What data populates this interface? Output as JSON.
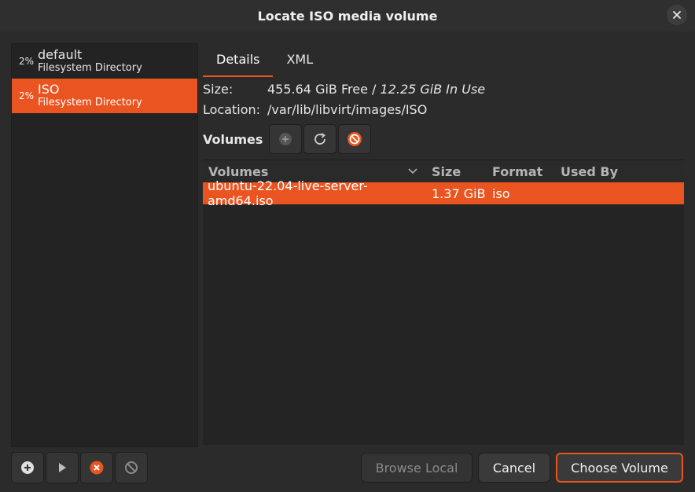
{
  "window": {
    "title": "Locate ISO media volume"
  },
  "pools": [
    {
      "percent": "2%",
      "name": "default",
      "type": "Filesystem Directory",
      "selected": false
    },
    {
      "percent": "2%",
      "name": "ISO",
      "type": "Filesystem Directory",
      "selected": true
    }
  ],
  "tabs": [
    {
      "label": "Details",
      "active": true
    },
    {
      "label": "XML",
      "active": false
    }
  ],
  "details": {
    "size_label": "Size:",
    "size_free": "455.64 GiB Free / ",
    "size_in_use": "12.25 GiB In Use",
    "location_label": "Location:",
    "location_value": "/var/lib/libvirt/images/ISO",
    "volumes_label": "Volumes"
  },
  "volume_table": {
    "headers": [
      "Volumes",
      "Size",
      "Format",
      "Used By"
    ],
    "rows": [
      {
        "name": "ubuntu-22.04-live-server-amd64.iso",
        "size": "1.37 GiB",
        "format": "iso",
        "used_by": ""
      }
    ]
  },
  "buttons": {
    "browse_local": "Browse Local",
    "cancel": "Cancel",
    "choose_volume": "Choose Volume"
  },
  "colors": {
    "accent": "#e95420",
    "background": "#2b2b2b"
  },
  "icons": {
    "pool_buttons": [
      "add-pool-icon",
      "start-pool-icon",
      "stop-pool-icon",
      "delete-pool-icon"
    ],
    "volume_buttons": [
      "add-volume-icon",
      "refresh-icon",
      "delete-volume-icon"
    ]
  }
}
